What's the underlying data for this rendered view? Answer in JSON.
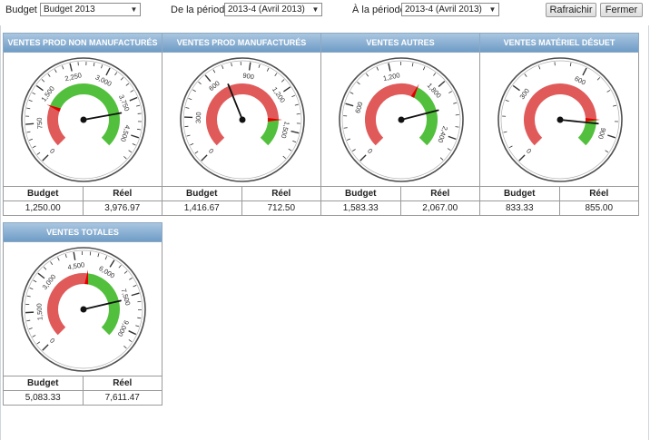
{
  "toolbar": {
    "budget_label": "Budget :",
    "budget_value": "Budget 2013",
    "from_label": "De la période :",
    "from_value": "2013-4 (Avril 2013)",
    "to_label": "À la période :",
    "to_value": "2013-4 (Avril 2013)",
    "refresh_label": "Rafraichir",
    "close_label": "Fermer"
  },
  "colors": {
    "red_zone": "#e05a5a",
    "green_zone": "#52c03d",
    "header_top": "#a9c6e0",
    "header_bottom": "#6f9cc6",
    "needle": "#111111",
    "target_marker": "#e00000"
  },
  "panels": [
    {
      "title": "VENTES PROD NON MANUFACTURÉS",
      "budget_header": "Budget",
      "actual_header": "Réel",
      "budget_value": "1,250.00",
      "actual_value": "3,976.97",
      "gauge": {
        "max": 5000,
        "target": 1250,
        "actual": 3976.97,
        "labels": [
          "0",
          "750",
          "1,500",
          "2,250",
          "3,000",
          "3,750",
          "4,500"
        ]
      }
    },
    {
      "title": "VENTES PROD MANUFACTURÉS",
      "budget_header": "Budget",
      "actual_header": "Réel",
      "budget_value": "1,416.67",
      "actual_value": "712.50",
      "gauge": {
        "max": 1700,
        "target": 1416.67,
        "actual": 712.5,
        "labels": [
          "0",
          "300",
          "600",
          "900",
          "1,200",
          "1,500"
        ]
      }
    },
    {
      "title": "VENTES AUTRES",
      "budget_header": "Budget",
      "actual_header": "Réel",
      "budget_value": "1,583.33",
      "actual_value": "2,067.00",
      "gauge": {
        "max": 2650,
        "target": 1583.33,
        "actual": 2067,
        "labels": [
          "0",
          "600",
          "1,200",
          "1,800",
          "2,400"
        ]
      }
    },
    {
      "title": "VENTES MATÉRIEL DÉSUET",
      "budget_header": "Budget",
      "actual_header": "Réel",
      "budget_value": "833.33",
      "actual_value": "855.00",
      "gauge": {
        "max": 1000,
        "target": 833.33,
        "actual": 855,
        "labels": [
          "0",
          "300",
          "600",
          "900"
        ]
      }
    },
    {
      "title": "VENTES TOTALES",
      "budget_header": "Budget",
      "actual_header": "Réel",
      "budget_value": "5,083.33",
      "actual_value": "7,611.47",
      "gauge": {
        "max": 9700,
        "target": 5083.33,
        "actual": 7611.47,
        "labels": [
          "0",
          "1,500",
          "3,000",
          "4,500",
          "6,000",
          "7,500",
          "9,000"
        ]
      }
    }
  ]
}
